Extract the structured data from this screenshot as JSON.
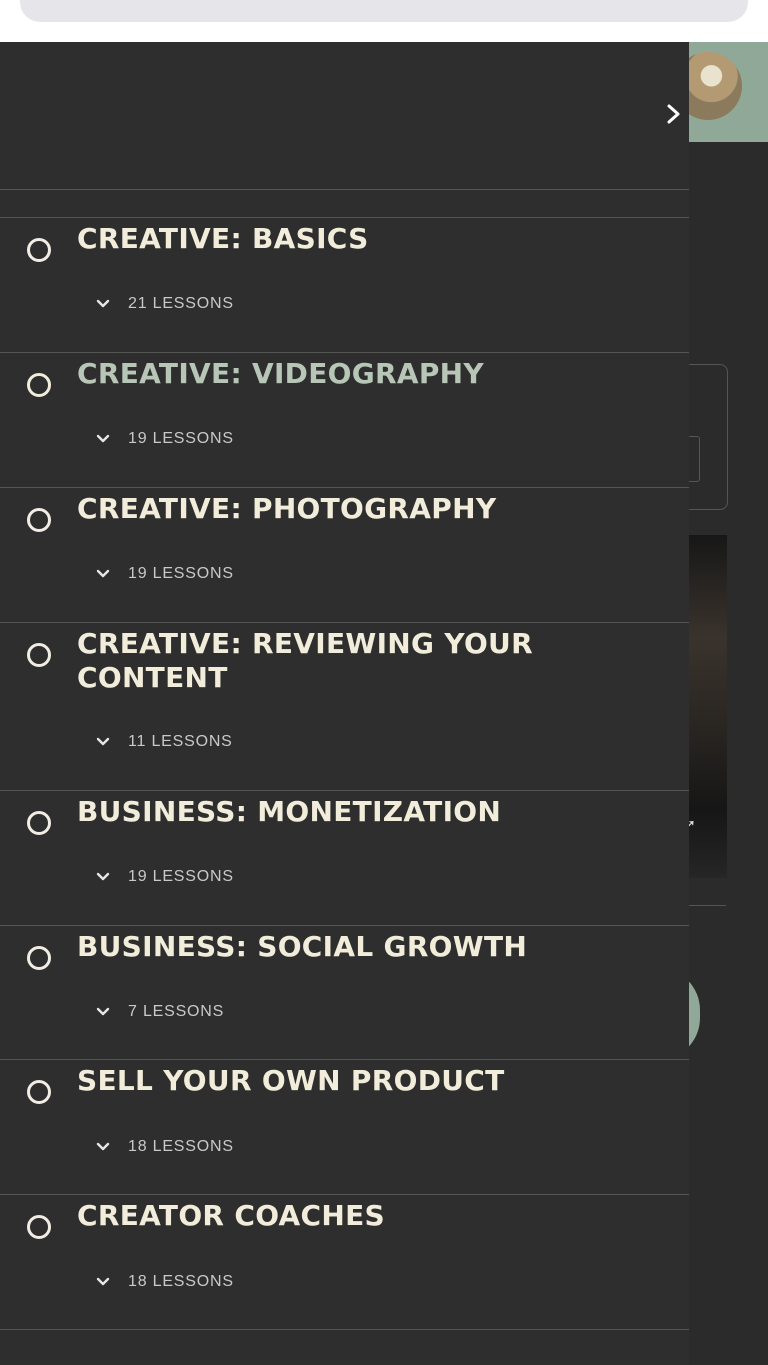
{
  "browser": {
    "url_fragment": "y"
  },
  "drawer": {
    "close_icon": "chevron-right-icon",
    "sections": [
      {
        "title": "CREATIVE: BASICS",
        "count": "21 LESSONS",
        "active": false
      },
      {
        "title": "CREATIVE: VIDEOGRAPHY",
        "count": "19 LESSONS",
        "active": true
      },
      {
        "title": "CREATIVE: PHOTOGRAPHY",
        "count": "19 LESSONS",
        "active": false
      },
      {
        "title": "CREATIVE: REVIEWING YOUR CONTENT",
        "count": "11 LESSONS",
        "active": false
      },
      {
        "title": "BUSINESS: MONETIZATION",
        "count": "19 LESSONS",
        "active": false
      },
      {
        "title": "BUSINESS: SOCIAL GROWTH",
        "count": "7 LESSONS",
        "active": false
      },
      {
        "title": "SELL YOUR OWN PRODUCT",
        "count": "18 LESSONS",
        "active": false
      },
      {
        "title": "CREATOR COACHES",
        "count": "18 LESSONS",
        "active": false
      }
    ]
  },
  "colors": {
    "drawer_bg": "#2e2e2e",
    "title": "#f2ecda",
    "title_active": "#b8c6b8",
    "accent_green": "#8fa898"
  }
}
